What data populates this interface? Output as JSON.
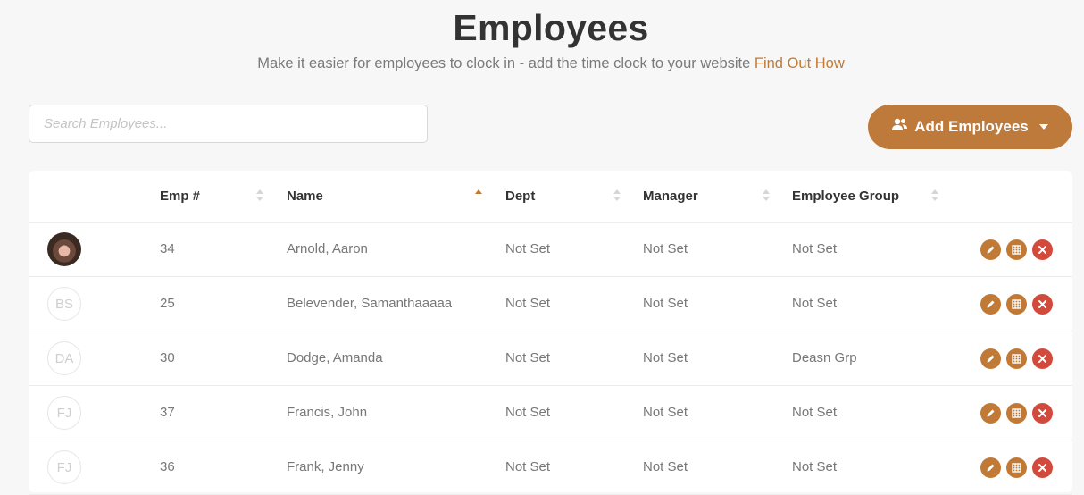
{
  "header": {
    "title": "Employees",
    "subtitle": "Make it easier for employees to clock in - add the time clock to your website",
    "subtitle_link": "Find Out How"
  },
  "search": {
    "placeholder": "Search Employees...",
    "value": ""
  },
  "add_button": {
    "label": "Add Employees"
  },
  "table": {
    "columns": [
      "Emp #",
      "Name",
      "Dept",
      "Manager",
      "Employee Group"
    ],
    "sorted_column": "Name",
    "sort_direction": "ascending",
    "rows": [
      {
        "avatar": "photo",
        "initials": "",
        "emp": "34",
        "name": "Arnold, Aaron",
        "dept": "Not Set",
        "manager": "Not Set",
        "group": "Not Set"
      },
      {
        "avatar": "initials",
        "initials": "BS",
        "emp": "25",
        "name": "Belevender, Samanthaaaaa",
        "dept": "Not Set",
        "manager": "Not Set",
        "group": "Not Set"
      },
      {
        "avatar": "initials",
        "initials": "DA",
        "emp": "30",
        "name": "Dodge, Amanda",
        "dept": "Not Set",
        "manager": "Not Set",
        "group": "Deasn Grp"
      },
      {
        "avatar": "initials",
        "initials": "FJ",
        "emp": "37",
        "name": "Francis, John",
        "dept": "Not Set",
        "manager": "Not Set",
        "group": "Not Set"
      },
      {
        "avatar": "initials",
        "initials": "FJ",
        "emp": "36",
        "name": "Frank, Jenny",
        "dept": "Not Set",
        "manager": "Not Set",
        "group": "Not Set"
      }
    ]
  },
  "row_actions": [
    "edit-icon",
    "timesheet-icon",
    "delete-icon"
  ],
  "colors": {
    "accent": "#c07a35",
    "button": "#bd7a3b",
    "danger": "#d24a3b",
    "background": "#f7f7f7"
  }
}
